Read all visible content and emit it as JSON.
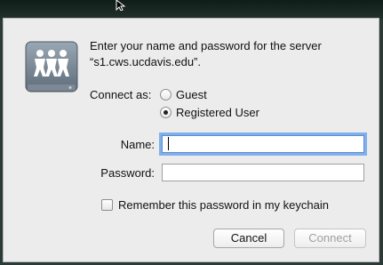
{
  "dialog": {
    "message_line1": "Enter your name and password for the server",
    "message_line2": "“s1.cws.ucdavis.edu”.",
    "connect_as_label": "Connect as:",
    "options": [
      {
        "label": "Guest",
        "selected": false
      },
      {
        "label": "Registered User",
        "selected": true
      }
    ],
    "name_label": "Name:",
    "name_value": "",
    "password_label": "Password:",
    "password_value": "",
    "remember_label": "Remember this password in my keychain",
    "remember_checked": false,
    "cancel_label": "Cancel",
    "connect_label": "Connect"
  },
  "icons": {
    "server": "shared-server-icon",
    "cursor": "mouse-pointer-icon"
  },
  "colors": {
    "focus_ring": "#7fb0ea",
    "dialog_bg": "#ececec"
  }
}
